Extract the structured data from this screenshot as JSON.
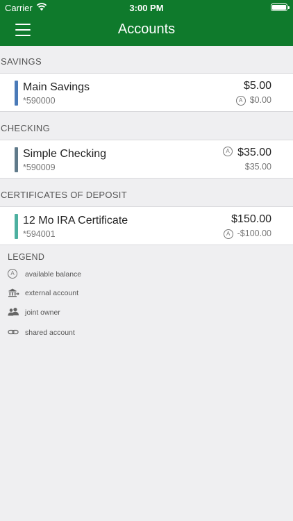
{
  "status_bar": {
    "carrier": "Carrier",
    "time": "3:00 PM"
  },
  "nav": {
    "title": "Accounts"
  },
  "sections": {
    "savings": {
      "header": "SAVINGS",
      "accounts": [
        {
          "name": "Main Savings",
          "number": "*590000",
          "balance": "$5.00",
          "available": "$0.00",
          "color": "#4a7ab8"
        }
      ]
    },
    "checking": {
      "header": "CHECKING",
      "accounts": [
        {
          "name": "Simple Checking",
          "number": "*590009",
          "balance": "$35.00",
          "available": "$35.00",
          "color": "#607a8a"
        }
      ]
    },
    "cds": {
      "header": "CERTIFICATES OF DEPOSIT",
      "accounts": [
        {
          "name": "12 Mo IRA Certificate",
          "number": "*594001",
          "balance": "$150.00",
          "available": "-$100.00",
          "color": "#4db0a0"
        }
      ]
    }
  },
  "legend": {
    "title": "LEGEND",
    "items": [
      {
        "icon": "available-balance-icon",
        "label": "available balance"
      },
      {
        "icon": "external-account-icon",
        "label": "external account"
      },
      {
        "icon": "joint-owner-icon",
        "label": "joint owner"
      },
      {
        "icon": "shared-account-icon",
        "label": "shared account"
      }
    ]
  },
  "avail_glyph": "A"
}
